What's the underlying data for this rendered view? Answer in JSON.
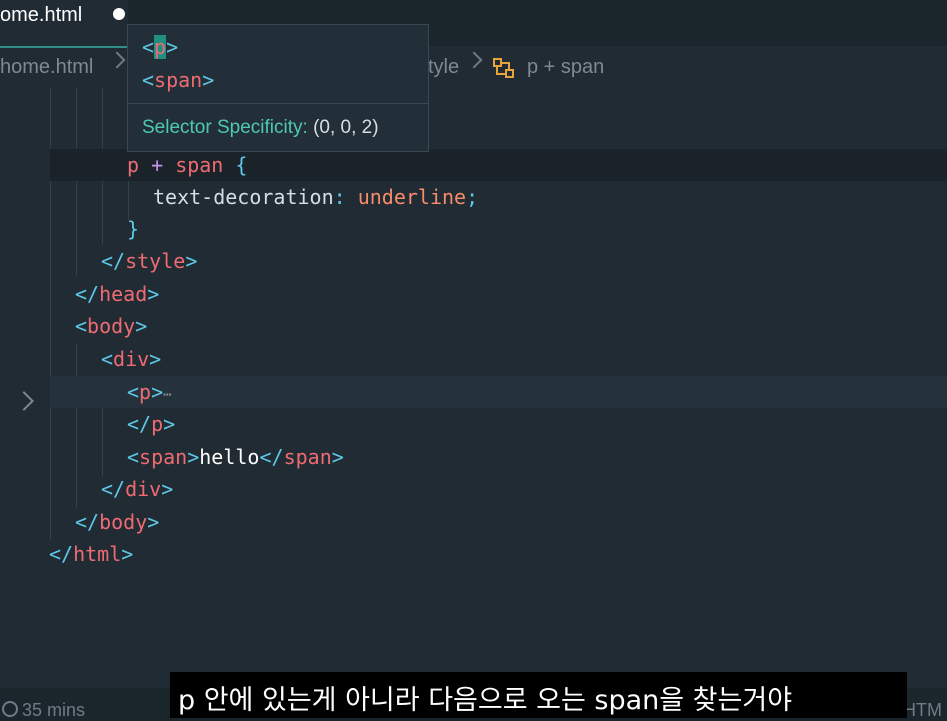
{
  "tab": {
    "title": "ome.html"
  },
  "breadcrumb": {
    "items": [
      "home.html",
      "tyle",
      "p + span"
    ]
  },
  "hover": {
    "line1": {
      "open": "<",
      "tag": "p",
      "close": ">"
    },
    "line2": {
      "open": "<",
      "tag": "span",
      "close": ">"
    },
    "specificity_label": "Selector Specificity:",
    "specificity_value": "(0, 0, 2)"
  },
  "code": {
    "sel_p": "p",
    "sel_plus": "+",
    "sel_span": "span",
    "sel_brace": "{",
    "prop": "text-decoration",
    "colon": ":",
    "value": "underline",
    "semi": ";",
    "close_brace": "}",
    "style_tag": "style",
    "head_tag": "head",
    "body_tag": "body",
    "div_tag": "div",
    "p_tag": "p",
    "fold_ellipsis": "⋯",
    "span_tag": "span",
    "span_text": "hello",
    "html_tag": "html",
    "lt": "<",
    "lt_slash": "</",
    "gt": ">"
  },
  "status": {
    "time": "35 mins",
    "right": "HTM"
  },
  "subtitle": {
    "text": "p 안에 있는게 아니라 다음으로 오는 span을 찾는거야"
  },
  "colors": {
    "background": "#202b33",
    "tag": "#ef6b73",
    "bracket": "#5fc8e8",
    "value": "#f78c6c",
    "accent": "#2f8f88"
  }
}
